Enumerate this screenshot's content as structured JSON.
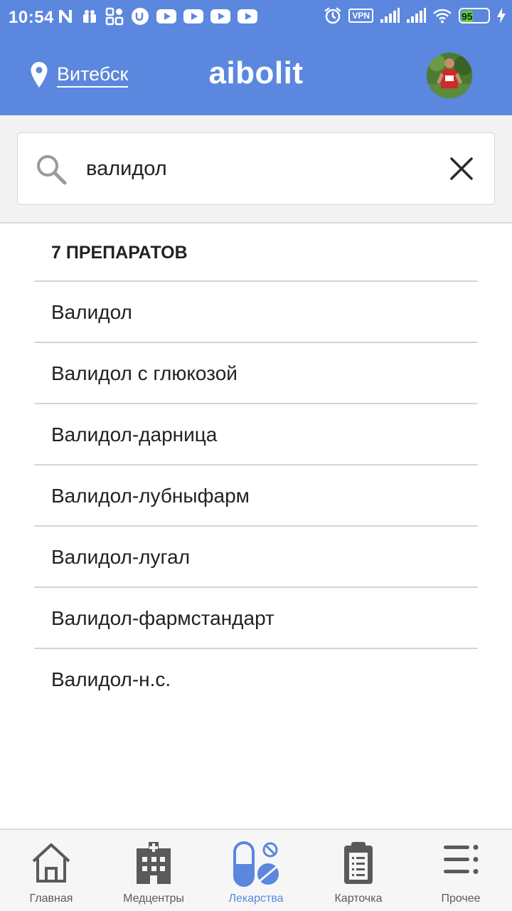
{
  "status_bar": {
    "time": "10:54",
    "vpn": "VPN",
    "battery": "95"
  },
  "header": {
    "city": "Витебск",
    "title": "aibolit"
  },
  "search": {
    "value": "валидол"
  },
  "results": {
    "count_label": "7 ПРЕПАРАТОВ",
    "items": [
      "Валидол",
      "Валидол с глюкозой",
      "Валидол-дарница",
      "Валидол-лубныфарм",
      "Валидол-лугал",
      "Валидол-фармстандарт",
      "Валидол-н.с."
    ]
  },
  "bottom_nav": {
    "items": [
      {
        "label": "Главная",
        "icon": "home-icon"
      },
      {
        "label": "Медцентры",
        "icon": "hospital-icon"
      },
      {
        "label": "Лекарства",
        "icon": "pills-icon"
      },
      {
        "label": "Карточка",
        "icon": "clipboard-icon"
      },
      {
        "label": "Прочее",
        "icon": "menu-icon"
      }
    ],
    "active_index": 2
  },
  "colors": {
    "brand": "#5b87de",
    "nav_inactive": "#5a5a5a",
    "battery": "#5ed13a"
  }
}
